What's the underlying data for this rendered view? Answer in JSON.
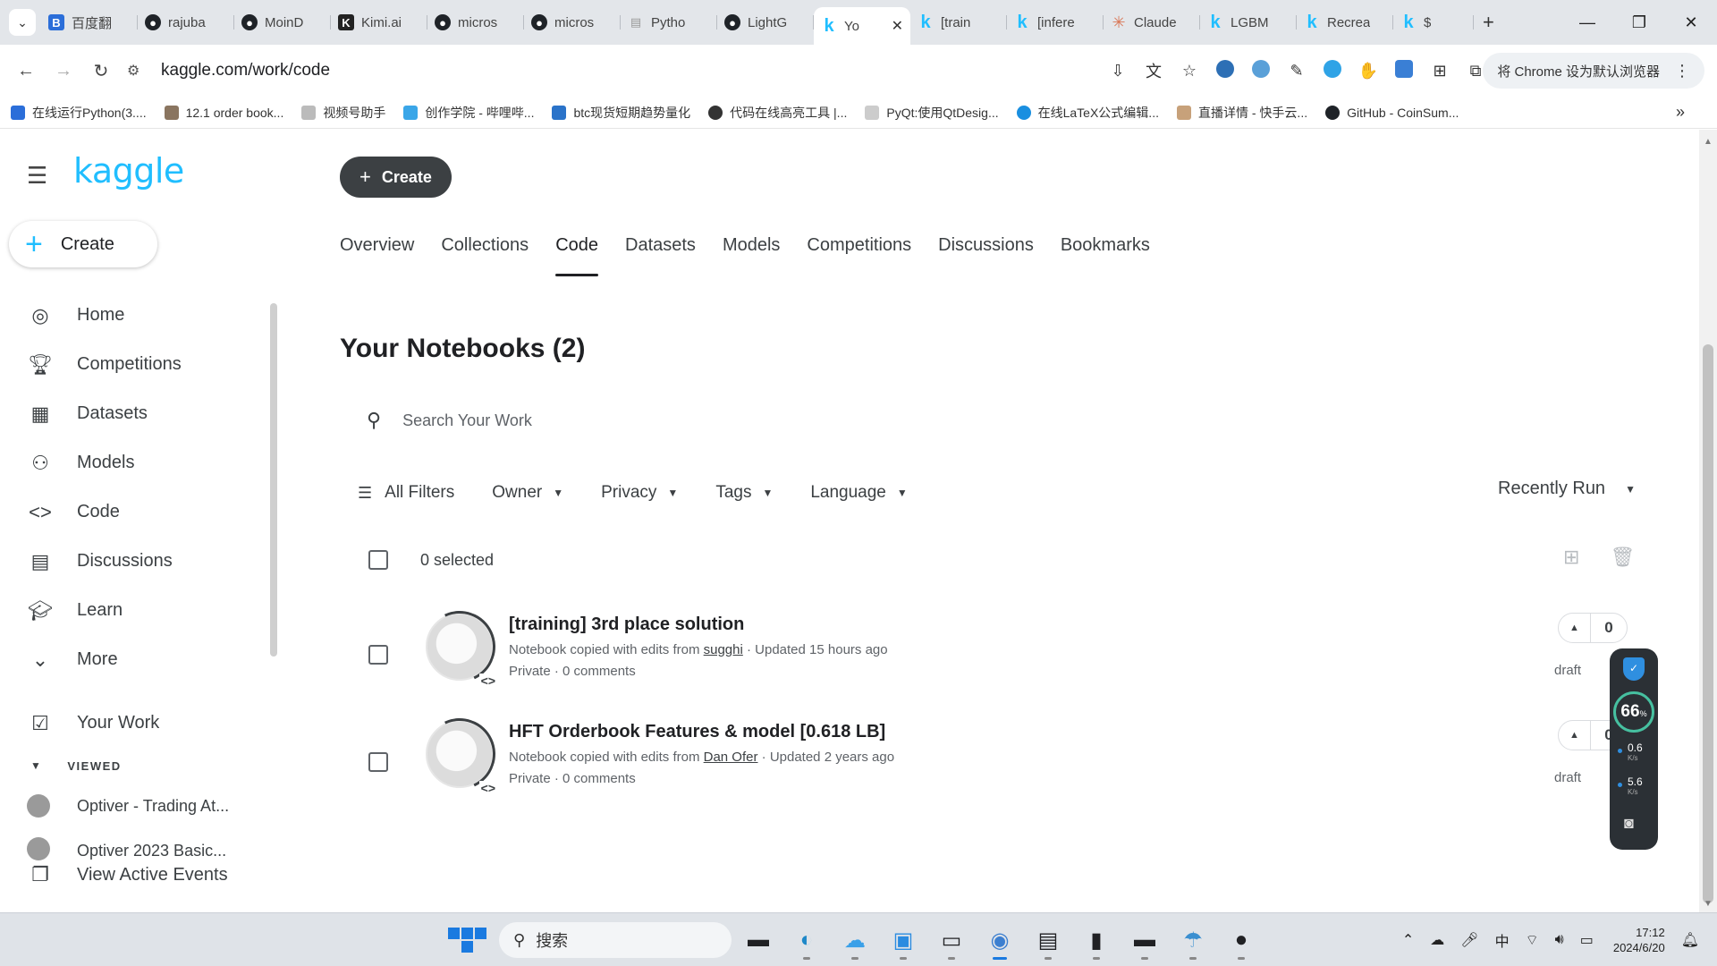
{
  "browser": {
    "tabs": [
      {
        "label": "百度翻",
        "icon": "baidu-translate-icon"
      },
      {
        "label": "rajuba",
        "icon": "github-icon"
      },
      {
        "label": "MoinD",
        "icon": "github-icon"
      },
      {
        "label": "Kimi.ai",
        "icon": "kimi-icon"
      },
      {
        "label": "micros",
        "icon": "github-icon"
      },
      {
        "label": "micros",
        "icon": "github-icon"
      },
      {
        "label": "Pytho",
        "icon": "python-doc-icon"
      },
      {
        "label": "LightG",
        "icon": "github-icon"
      },
      {
        "label": "Yo",
        "icon": "kaggle-icon",
        "active": true
      },
      {
        "label": "[train",
        "icon": "kaggle-icon"
      },
      {
        "label": "[infere",
        "icon": "kaggle-icon"
      },
      {
        "label": "Claude",
        "icon": "claude-icon"
      },
      {
        "label": "LGBM",
        "icon": "kaggle-icon"
      },
      {
        "label": "Recrea",
        "icon": "kaggle-icon"
      },
      {
        "label": "$",
        "icon": "kaggle-icon"
      }
    ],
    "url": "kaggle.com/work/code",
    "default_browser_button": "将 Chrome 设为默认浏览器",
    "bookmarks": [
      "在线运行Python(3....",
      "12.1 order book...",
      "视频号助手",
      "创作学院 - 哔哩哔...",
      "btc现货短期趋势量化",
      "代码在线高亮工具 |...",
      "PyQt:使用QtDesig...",
      "在线LaTeX公式编辑...",
      "直播详情 - 快手云...",
      "GitHub - CoinSum..."
    ]
  },
  "kaggle": {
    "logo": "kaggle",
    "side_create": "Create",
    "top_create": "Create",
    "sidebar": [
      {
        "label": "Home",
        "icon": "compass-icon"
      },
      {
        "label": "Competitions",
        "icon": "trophy-icon"
      },
      {
        "label": "Datasets",
        "icon": "table-icon"
      },
      {
        "label": "Models",
        "icon": "models-icon"
      },
      {
        "label": "Code",
        "icon": "code-icon"
      },
      {
        "label": "Discussions",
        "icon": "discussion-icon"
      },
      {
        "label": "Learn",
        "icon": "graduation-cap-icon"
      },
      {
        "label": "More",
        "icon": "chevron-down-icon"
      }
    ],
    "your_work": "Your Work",
    "viewed_label": "VIEWED",
    "viewed": [
      "Optiver - Trading At...",
      "Optiver 2023 Basic..."
    ],
    "active_events": "View Active Events",
    "tabs": [
      "Overview",
      "Collections",
      "Code",
      "Datasets",
      "Models",
      "Competitions",
      "Discussions",
      "Bookmarks"
    ],
    "active_tab": "Code",
    "title": "Your Notebooks (2)",
    "search_placeholder": "Search Your Work",
    "filters": [
      "All Filters",
      "Owner",
      "Privacy",
      "Tags",
      "Language"
    ],
    "sort": "Recently Run",
    "selected": "0 selected",
    "notebooks": [
      {
        "title": "[training] 3rd place solution",
        "meta_prefix": "Notebook copied with edits from ",
        "author": "sugghi",
        "meta_suffix": " · Updated 15 hours ago",
        "privacy": "Private · 0 comments",
        "votes": "0",
        "status": "draft"
      },
      {
        "title": "HFT Orderbook Features & model [0.618 LB]",
        "meta_prefix": "Notebook copied with edits from ",
        "author": "Dan Ofer",
        "meta_suffix": " · Updated 2 years ago",
        "privacy": "Private · 0 comments",
        "votes": "0",
        "status": "draft"
      }
    ]
  },
  "widget": {
    "percent": "66",
    "unit": "%",
    "up": "0.6",
    "down": "5.6",
    "rate_unit": "K/s"
  },
  "taskbar": {
    "search": "搜索",
    "time": "17:12",
    "date": "2024/6/20",
    "ime": "中"
  }
}
